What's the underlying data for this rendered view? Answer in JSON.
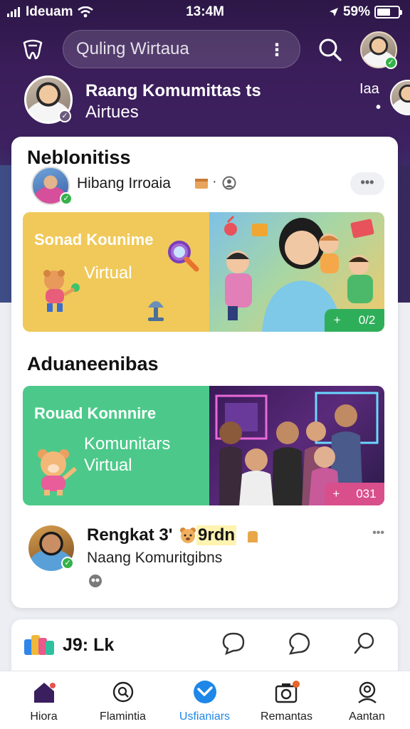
{
  "status_bar": {
    "carrier": "Ideuam",
    "time": "13:4M",
    "battery": "59%"
  },
  "search": {
    "placeholder": "Quling Wirtaua"
  },
  "community": {
    "name": "Raang Komumittas ts",
    "subtitle": "Airtues",
    "side_label": "Iaa",
    "side_dot": "•"
  },
  "section1": {
    "title": "Neblonitiss",
    "post_name": "Hibang Irroaia",
    "banner_title": "Sonad Kounime",
    "banner_sub": "Virtual",
    "badge_plus": "+",
    "badge_count": "0/2"
  },
  "section2": {
    "title": "Aduaneenibas",
    "banner_title": "Rouad Konnnire",
    "banner_sub_1": "Komunitars",
    "banner_sub_2": "Virtual",
    "badge_plus": "+",
    "badge_count": "031"
  },
  "person": {
    "name": "Rengkat 3'",
    "emoji_label": "9rdn",
    "subtitle": "Naang Komuritgibns"
  },
  "bottom_card": {
    "label": "J9: Lk"
  },
  "nav": {
    "items": [
      {
        "label": "Hiora"
      },
      {
        "label": "Flamintia"
      },
      {
        "label": "Usfianiars"
      },
      {
        "label": "Remantas"
      },
      {
        "label": "Aantan"
      }
    ]
  },
  "colors": {
    "header_purple": "#2c1747",
    "banner1_yellow": "#f0c95a",
    "banner2_green": "#4cc98a",
    "badge_green": "#2fae5a",
    "badge_pink": "#d94f8c",
    "active_nav": "#1e87e8",
    "verify_green": "#35b24a"
  },
  "icons": {
    "app": "tooth-icon",
    "search": "search-icon",
    "nav": [
      "home-icon",
      "search-icon",
      "chat-icon",
      "camera-icon",
      "profile-icon"
    ]
  }
}
